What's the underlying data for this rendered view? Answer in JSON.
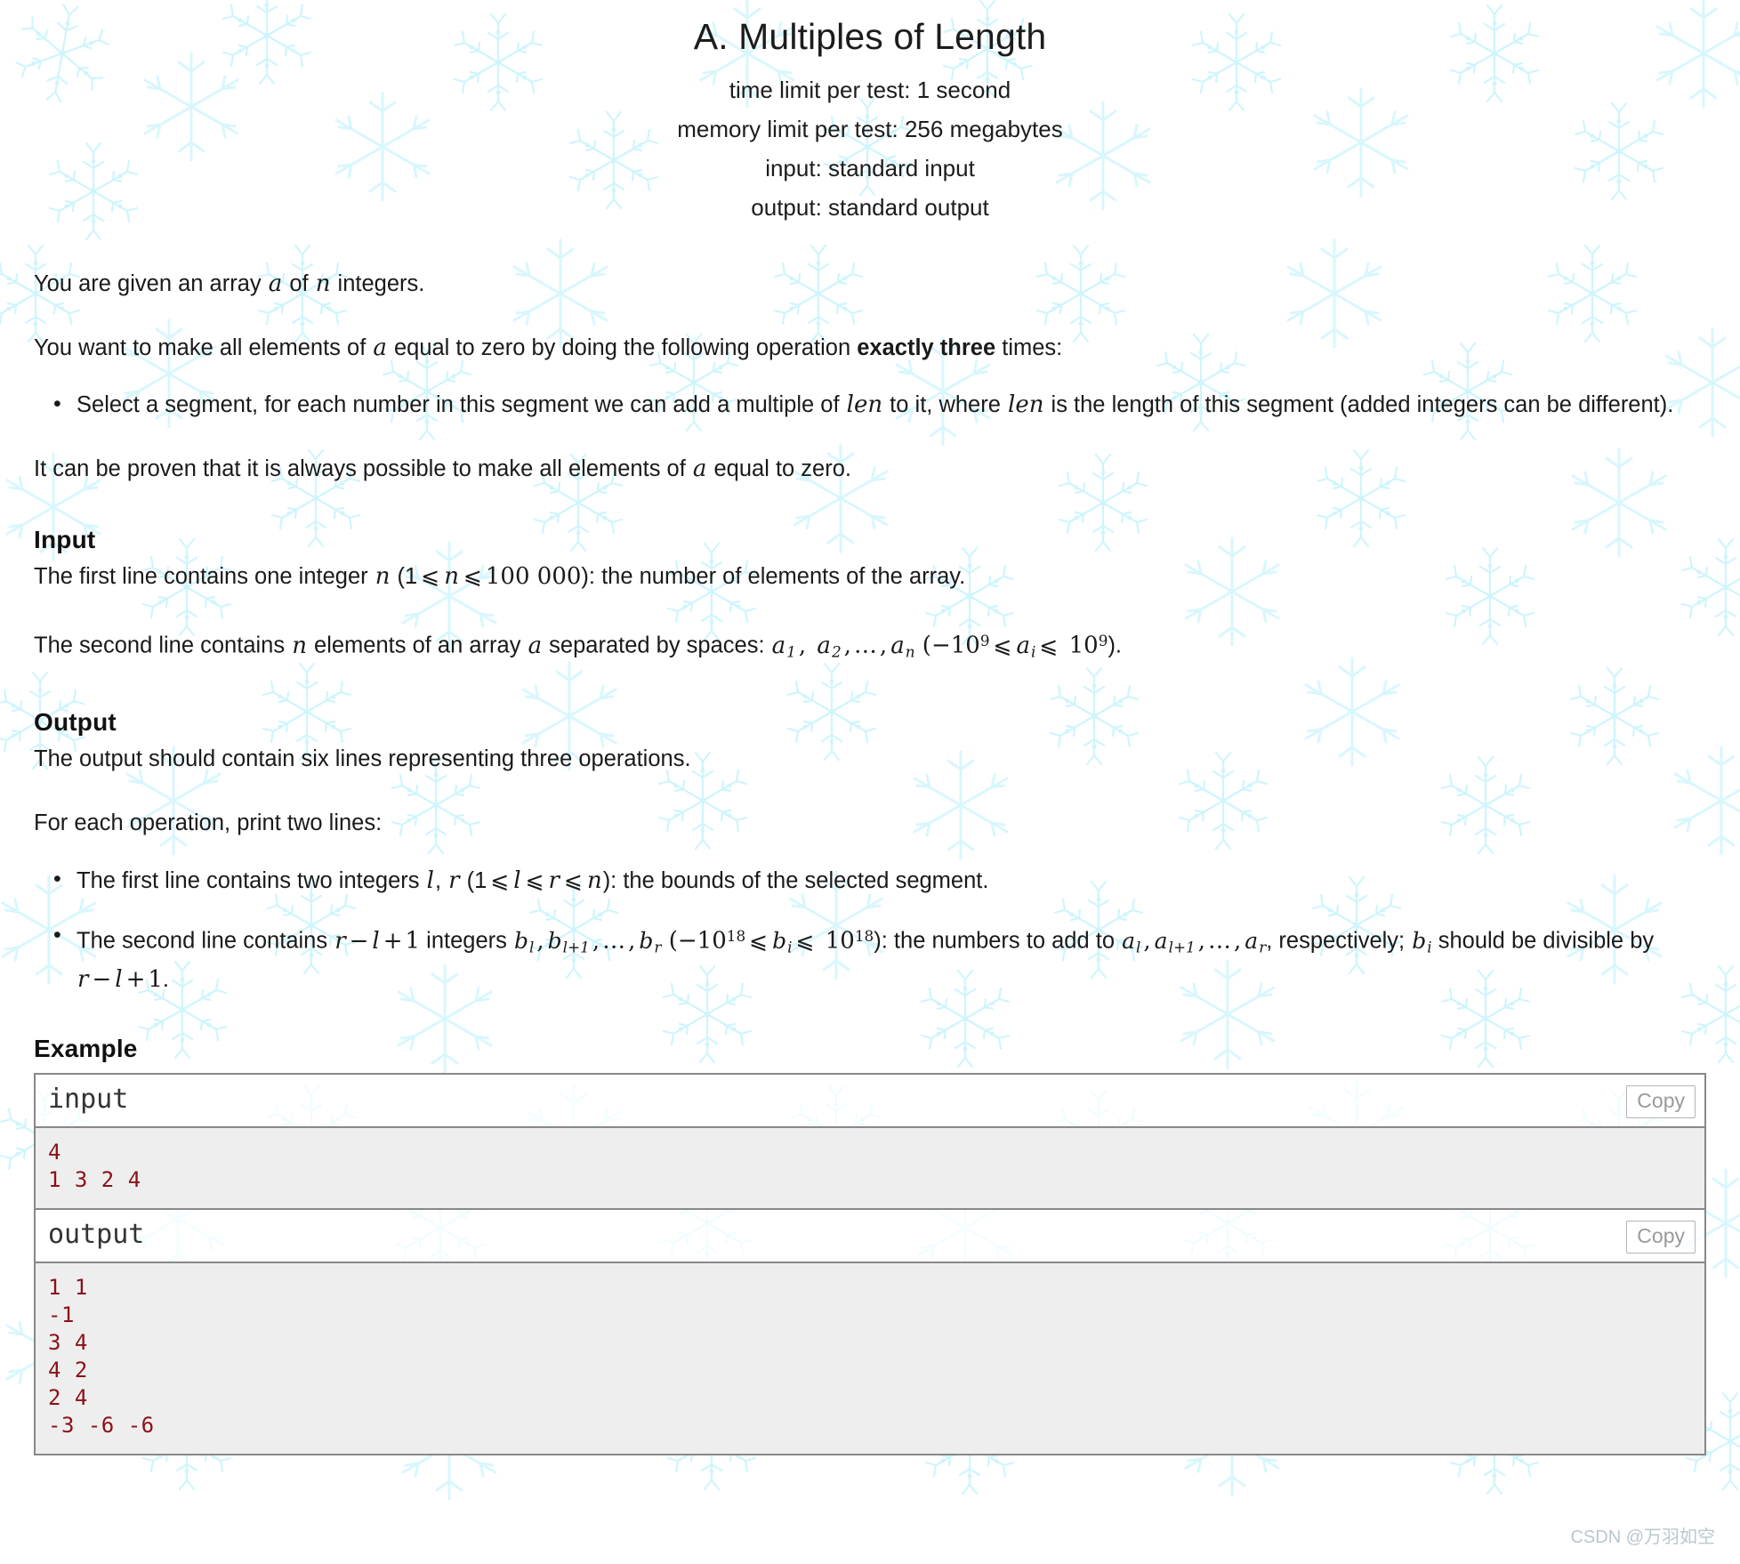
{
  "header": {
    "title": "A. Multiples of Length",
    "limits": [
      "time limit per test: 1 second",
      "memory limit per test: 256 megabytes",
      "input: standard input",
      "output: standard output"
    ]
  },
  "statement": {
    "p1_a": "You are given an array ",
    "p1_var_a": "a",
    "p1_b": " of ",
    "p1_var_n": "n",
    "p1_c": " integers.",
    "p2_a": "You want to make all elements of ",
    "p2_var_a": "a",
    "p2_b": " equal to zero by doing the following operation ",
    "p2_bold": "exactly three",
    "p2_c": " times:",
    "bullet1_a": "Select a segment, for each number in this segment we can add a multiple of ",
    "bullet1_len1": "len",
    "bullet1_b": " to it, where ",
    "bullet1_len2": "len",
    "bullet1_c": " is the length of this segment (added integers can be different).",
    "p3_a": "It can be proven that it is always possible to make all elements of ",
    "p3_var_a": "a",
    "p3_b": " equal to zero."
  },
  "input_section": {
    "heading": "Input",
    "line1_a": "The first line contains one integer ",
    "line1_n": "n",
    "line1_b": " (1",
    "le1": "⩽",
    "line1_n2": "n",
    "le2": "⩽",
    "line1_max": "100 000",
    "line1_c": "): the number of elements of the array.",
    "line2_a": "The second line contains ",
    "line2_n": "n",
    "line2_b": " elements of an array ",
    "line2_a_var": "a",
    "line2_c": " separated by spaces: ",
    "a1": "a",
    "a1_sub": "1",
    "a2": "a",
    "a2_sub": "2",
    "dots": "…",
    "an": "a",
    "an_sub": "n",
    "line2_open": " (−10",
    "exp9a": "9",
    "le3": "⩽",
    "ai": "a",
    "ai_sub": "i",
    "le4": "⩽",
    "line2_ten": " 10",
    "exp9b": "9",
    "line2_close": ")."
  },
  "output_section": {
    "heading": "Output",
    "line1": "The output should contain six lines representing three operations.",
    "line2": "For each operation, print two lines:",
    "bullet1_a": "The first line contains two integers ",
    "b1_l": "l",
    "b1_comma": ", ",
    "b1_r": "r",
    "bullet1_b": " (1",
    "le1": "⩽",
    "b1_l2": "l",
    "le2": "⩽",
    "b1_r2": "r",
    "le3": "⩽",
    "b1_n": "n",
    "bullet1_c": "): the bounds of the selected segment.",
    "bullet2_a": "The second line contains ",
    "b2_r": "r",
    "b2_minus": "−",
    "b2_l": "l",
    "b2_plus": "+",
    "b2_one": "1",
    "bullet2_b": " integers ",
    "bl": "b",
    "bl_sub": "l",
    "bl1": "b",
    "bl1_sub": "l+1",
    "dots": "…",
    "br": "b",
    "br_sub": "r",
    "bullet2_open": " (−10",
    "exp18a": "18",
    "le4": "⩽",
    "bi": "b",
    "bi_sub": "i",
    "le5": "⩽",
    "b2_ten": " 10",
    "exp18b": "18",
    "bullet2_c": "): the numbers to add to ",
    "al": "a",
    "al_sub": "l",
    "al1": "a",
    "al1_sub": "l+1",
    "dots2": "…",
    "ar": "a",
    "ar_sub": "r",
    "bullet2_d": ", respectively; ",
    "bi2": "b",
    "bi2_sub": "i",
    "bullet2_e": " should be divisible by ",
    "b2_r3": "r",
    "b2_minus3": "−",
    "b2_l3": "l",
    "b2_plus3": "+",
    "b2_one3": "1",
    "bullet2_f": "."
  },
  "example": {
    "heading": "Example",
    "input_label": "input",
    "output_label": "output",
    "copy_label": "Copy",
    "input_code": "4\n1 3 2 4",
    "output_code": "1 1\n-1\n3 4\n4 2\n2 4\n-3 -6 -6"
  },
  "watermark": "CSDN @万羽如空",
  "colors": {
    "snowflake": "#ccf5fc",
    "code_text": "#8b1118",
    "code_bg": "#eeeeee",
    "border": "#888888",
    "copy_text": "#9a9a9a"
  }
}
